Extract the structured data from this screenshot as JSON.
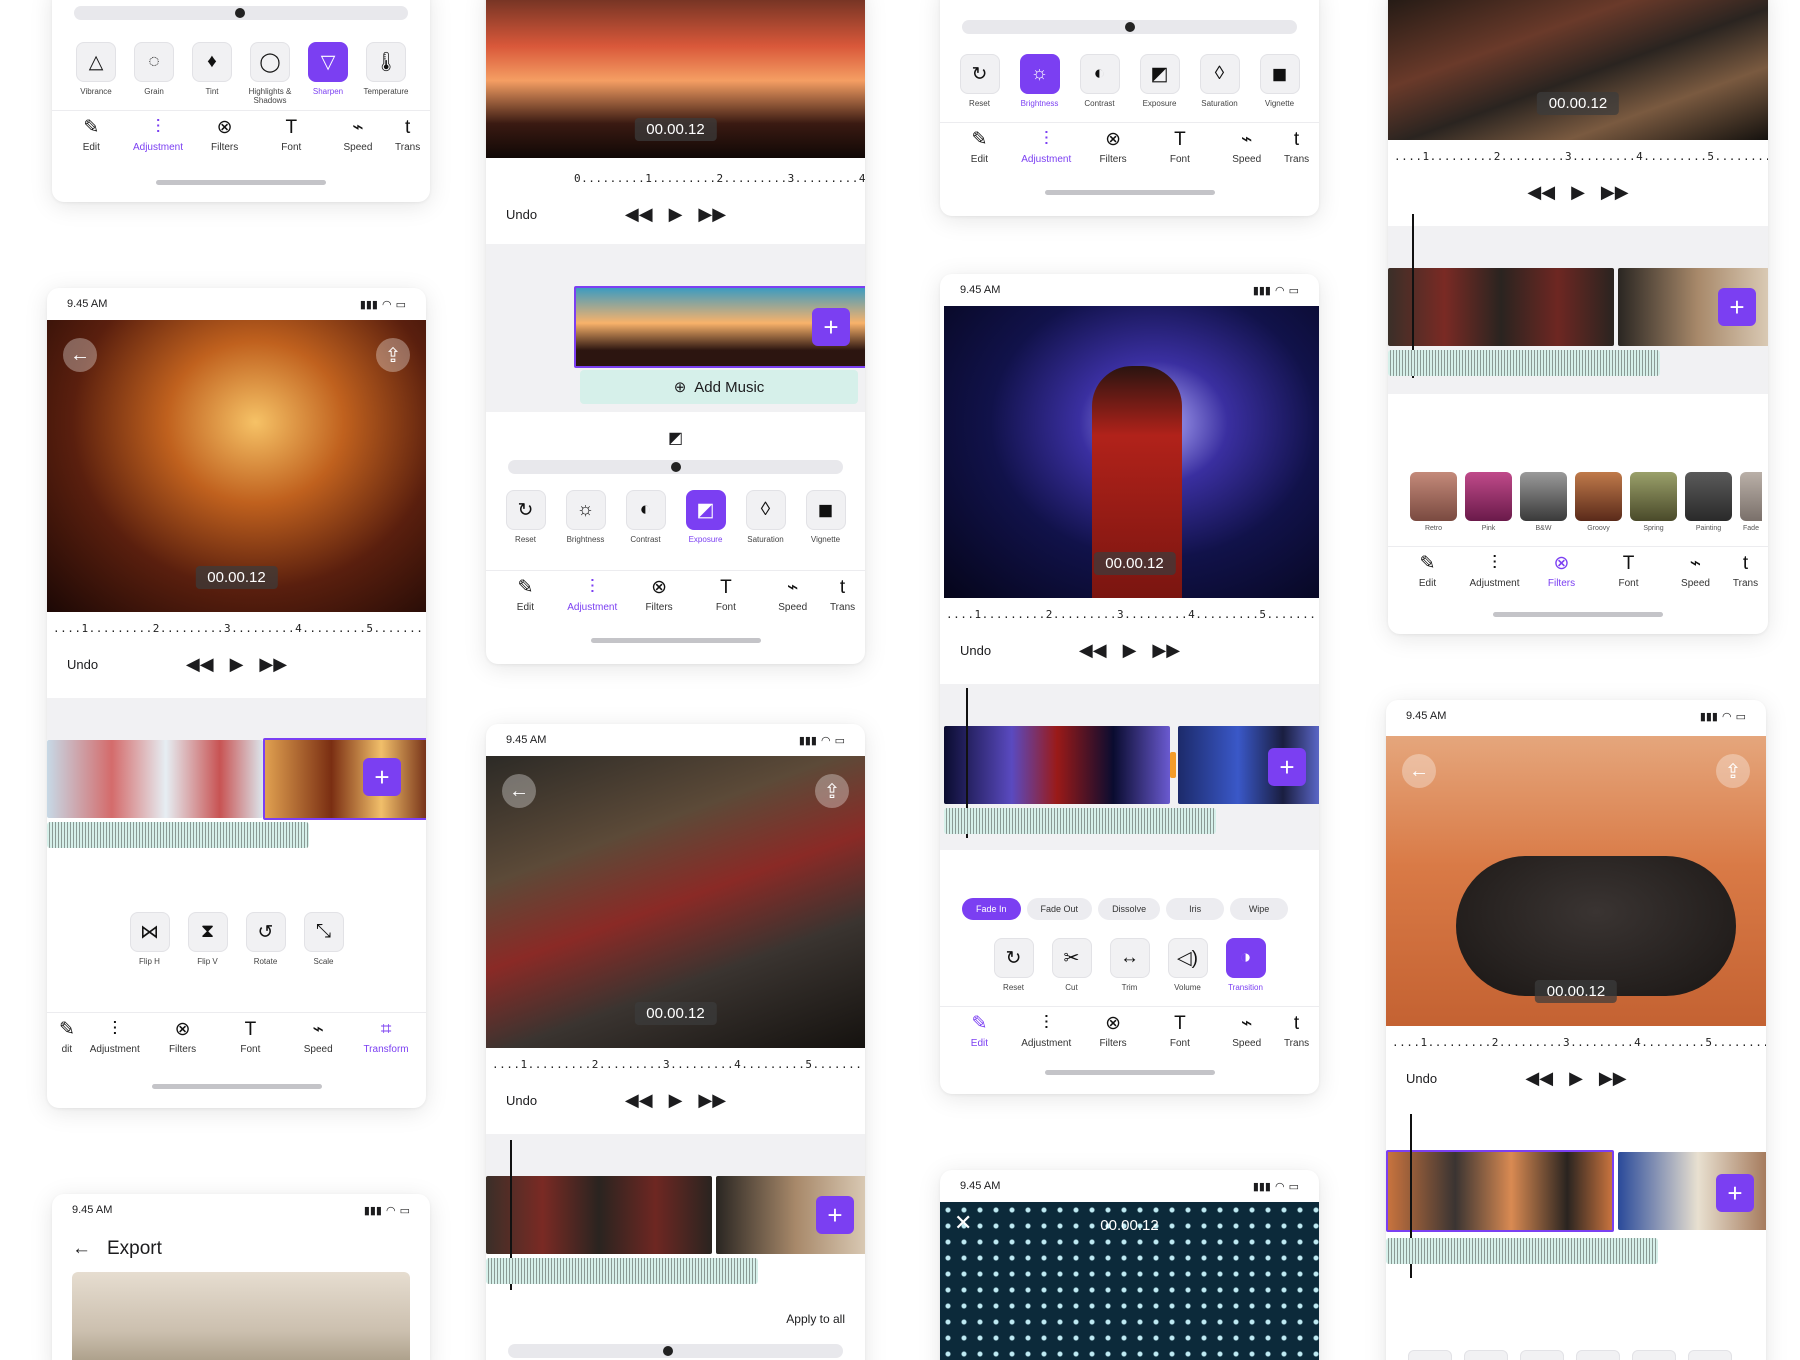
{
  "status": {
    "time": "9.45 AM"
  },
  "timecode": "00.00.12",
  "transport": {
    "undo": "Undo",
    "rewind_icon": "◀◀",
    "play_icon": "▶",
    "forward_icon": "▶▶"
  },
  "ruler": "....1.........2.........3.........4.........5.........6.........7....",
  "ruler_short": "0.........1.........2.........3.........4.........",
  "nav": {
    "edit": "Edit",
    "adjustment": "Adjustment",
    "filters": "Filters",
    "font": "Font",
    "speed": "Speed",
    "trans": "Trans",
    "transform": "Transform",
    "edit_cut": "dit"
  },
  "adjust_tools": {
    "vibrance": "Vibrance",
    "grain": "Grain",
    "tint": "Tint",
    "highlights": "Highlights & Shadows",
    "sharpen": "Sharpen",
    "temperature": "Temperature",
    "reset": "Reset",
    "brightness": "Brightness",
    "contrast": "Contrast",
    "exposure": "Exposure",
    "saturation": "Saturation",
    "vignette": "Vignette"
  },
  "transform_tools": {
    "flip_h": "Flip H",
    "flip_v": "Flip V",
    "rotate": "Rotate",
    "scale": "Scale"
  },
  "transition": {
    "options": [
      "Fade In",
      "Fade Out",
      "Dissolve",
      "Iris",
      "Wipe"
    ],
    "tools": {
      "reset": "Reset",
      "cut": "Cut",
      "trim": "Trim",
      "volume": "Volume",
      "transition": "Transition"
    }
  },
  "filters_list": [
    "Retro",
    "Pink",
    "B&W",
    "Groovy",
    "Spring",
    "Painting",
    "Fade"
  ],
  "add_music": "Add Music",
  "apply_all": "Apply to all",
  "export": {
    "title": "Export"
  },
  "colors": {
    "accent": "#7b3ff2",
    "wave": "#d6f0ea"
  }
}
